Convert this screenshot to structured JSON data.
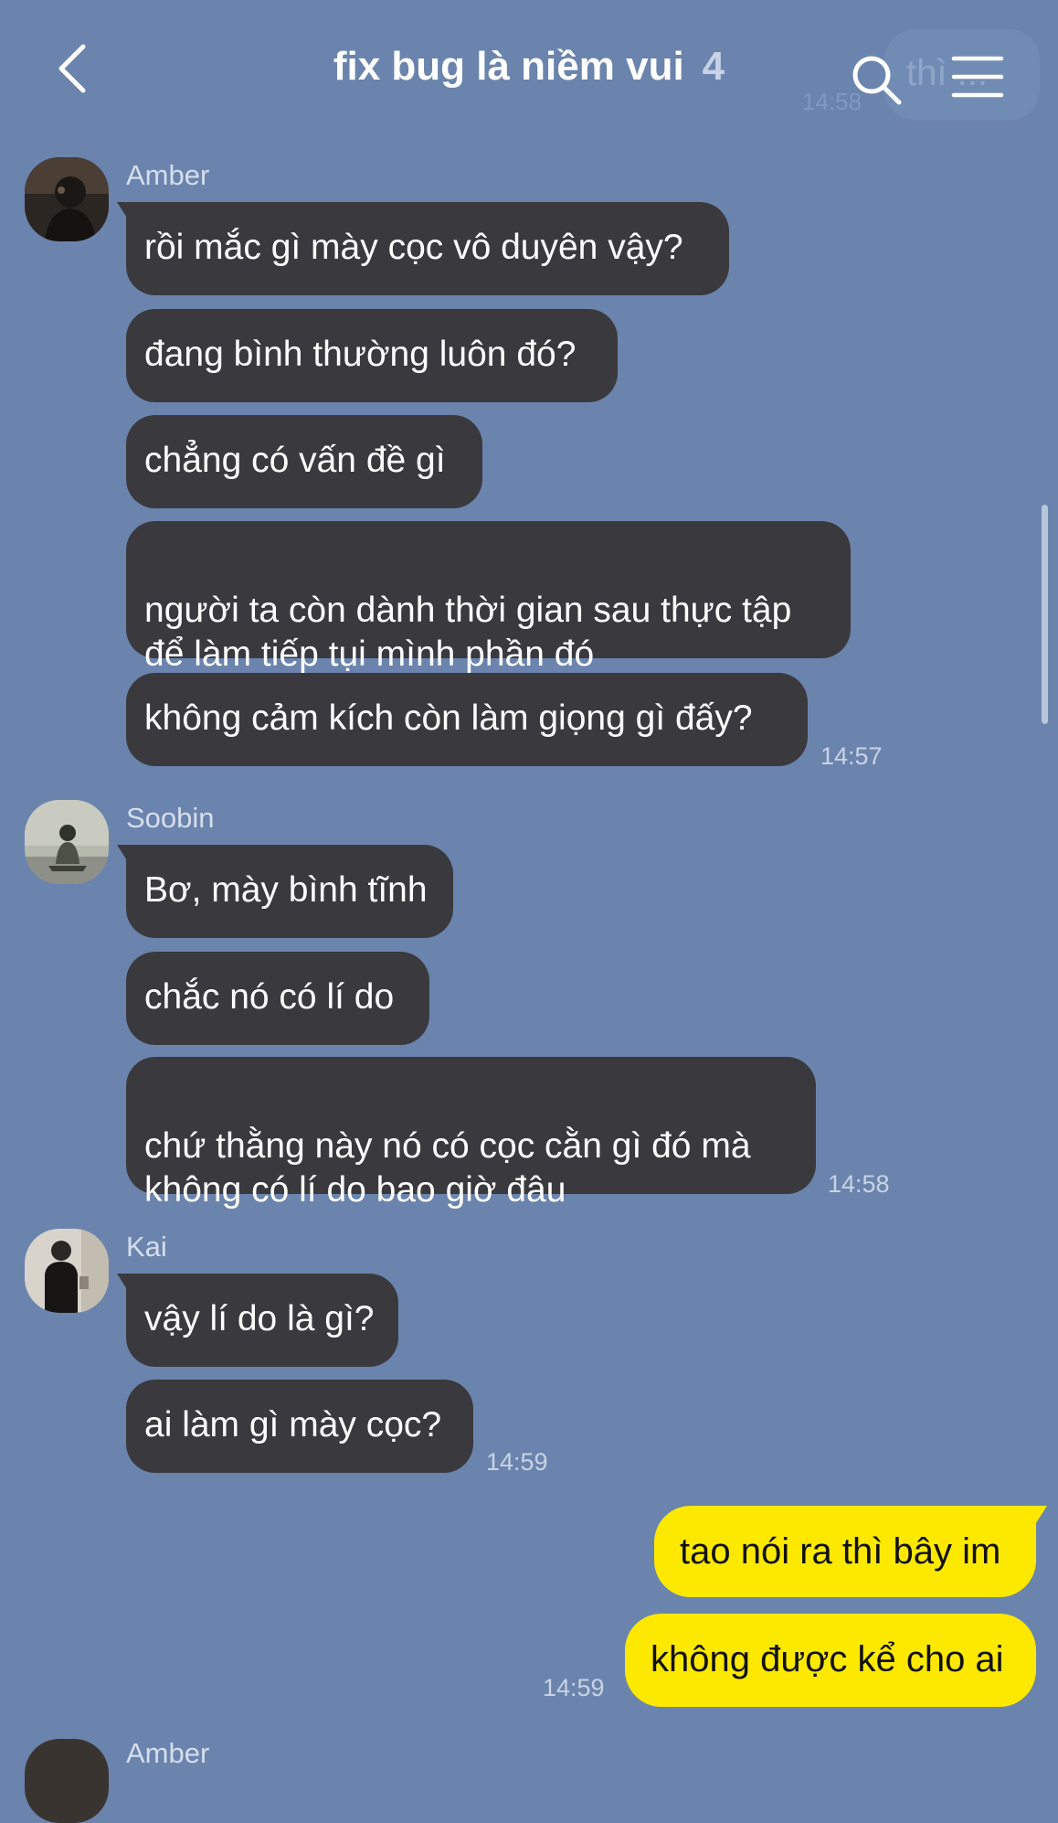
{
  "header": {
    "title": "fix bug là niềm vui",
    "member_count": "4",
    "back_icon": "chevron-left-icon",
    "search_icon": "search-icon",
    "menu_icon": "hamburger-menu-icon",
    "ghost_text": "thì ... ",
    "ghost_time": "14:58"
  },
  "messages": [
    {
      "sender": "Amber",
      "bubbles": [
        "rồi mắc gì mày cọc vô duyên vậy?",
        "đang bình thường luôn đó?",
        "chẳng có vấn đề gì",
        "người ta còn dành thời gian sau thực tập\nđể làm tiếp tụi mình phần đó",
        "không cảm kích còn làm giọng gì đấy?"
      ],
      "time": "14:57"
    },
    {
      "sender": "Soobin",
      "bubbles": [
        "Bơ, mày bình tĩnh",
        "chắc nó có lí do",
        "chứ thằng này nó có cọc cằn gì đó mà\nkhông có lí do bao giờ đâu"
      ],
      "time": "14:58"
    },
    {
      "sender": "Kai",
      "bubbles": [
        "vậy lí do là gì?",
        "ai làm gì mày cọc?"
      ],
      "time": "14:59"
    }
  ],
  "my_messages": {
    "bubbles": [
      "tao nói ra thì bây im",
      "không được kể cho ai"
    ],
    "time": "14:59"
  },
  "next_sender": "Amber",
  "colors": {
    "background": "#6a84ad",
    "incoming_bubble": "#3a393d",
    "outgoing_bubble": "#fde900"
  }
}
